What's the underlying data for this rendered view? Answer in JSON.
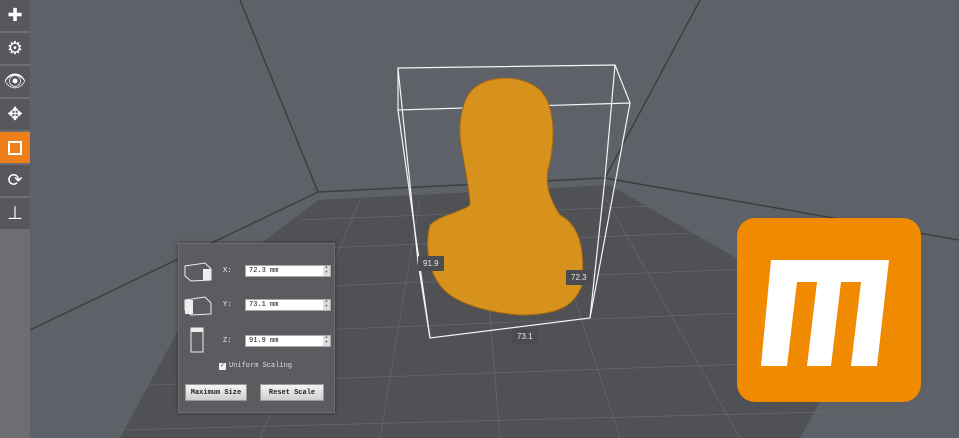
{
  "toolbar": {
    "items": [
      {
        "name": "add",
        "icon": "plus-icon"
      },
      {
        "name": "settings",
        "icon": "gear-icon"
      },
      {
        "name": "view",
        "icon": "eye-icon"
      },
      {
        "name": "move",
        "icon": "move-icon"
      },
      {
        "name": "scale",
        "icon": "scale-icon",
        "active": true
      },
      {
        "name": "rotate",
        "icon": "rotate-icon"
      },
      {
        "name": "lay-flat",
        "icon": "lay-flat-icon"
      }
    ],
    "accent": "#ee7f1a"
  },
  "scale_panel": {
    "x": {
      "label": "X:",
      "value": "72.3 mm"
    },
    "y": {
      "label": "Y:",
      "value": "73.1 mm"
    },
    "z": {
      "label": "Z:",
      "value": "91.9 mm"
    },
    "uniform_label": "Uniform Scaling",
    "uniform_checked": true,
    "max_size_label": "Maximum Size",
    "reset_label": "Reset Scale"
  },
  "dimensions": {
    "height": "91.9",
    "width": "72.3",
    "depth": "73.1"
  },
  "logo": {
    "text": "m",
    "color": "#f08a00"
  }
}
